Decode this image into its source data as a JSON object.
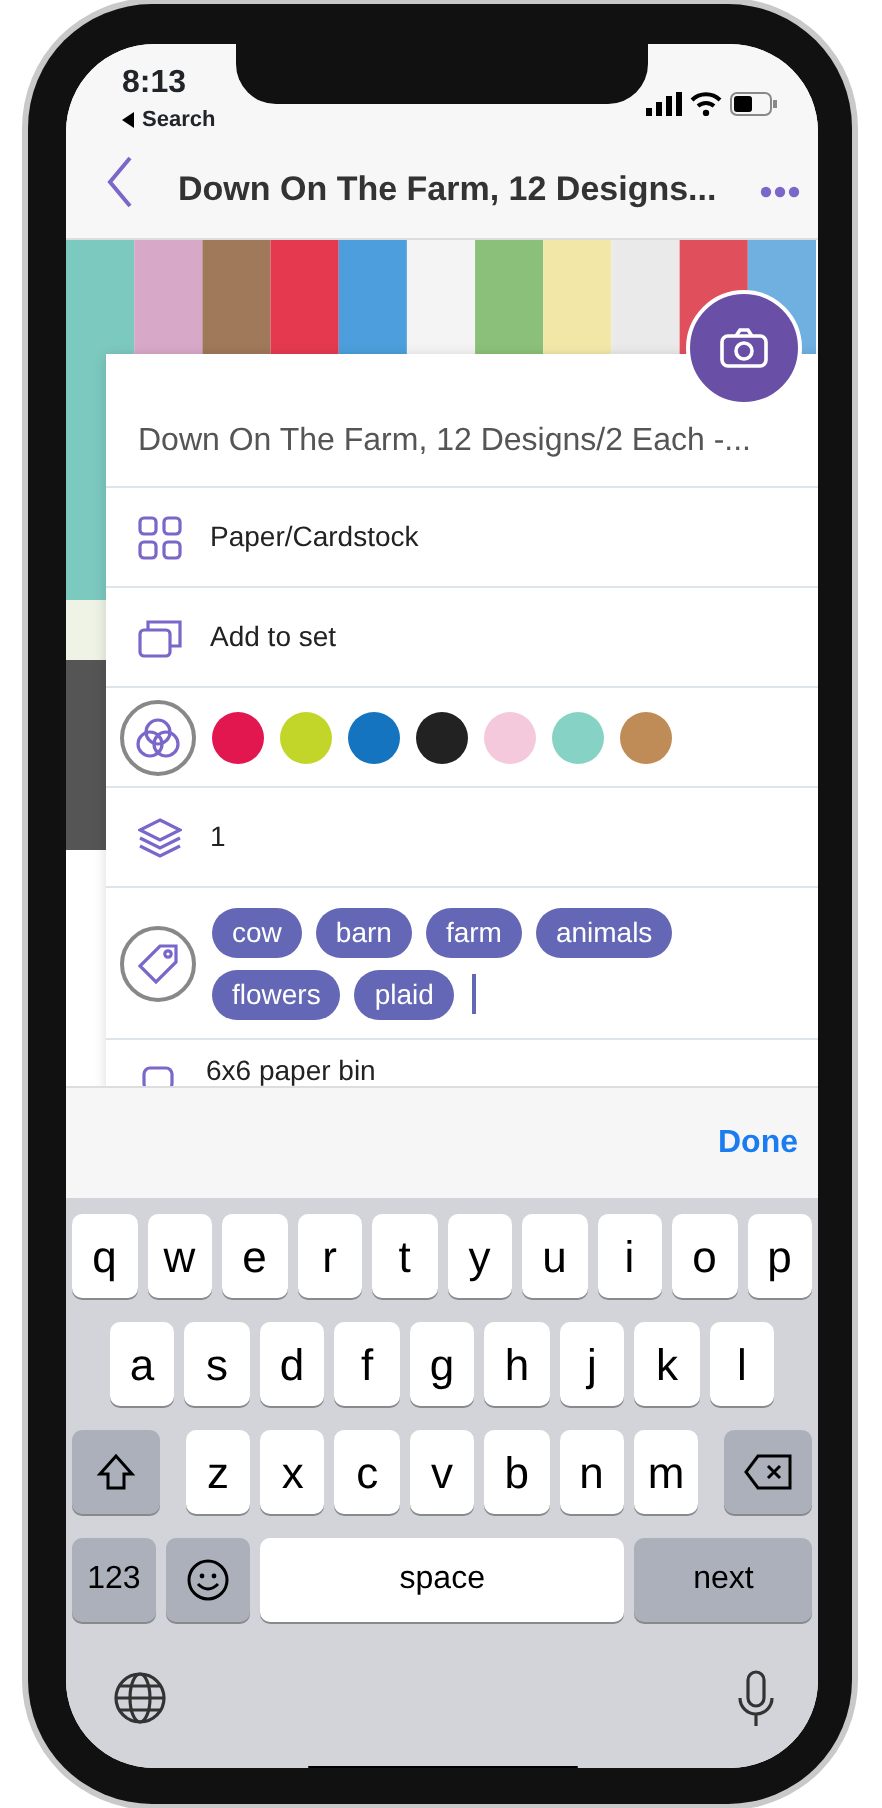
{
  "status_bar": {
    "time": "8:13",
    "back_app": "Search"
  },
  "nav": {
    "title": "Down On The Farm, 12 Designs..."
  },
  "item": {
    "title": "Down On The Farm, 12 Designs/2 Each -...",
    "category": "Paper/Cardstock",
    "set": "Add to set",
    "colors": [
      {
        "color": "#e3174f"
      },
      {
        "color": "#c2d62a"
      },
      {
        "color": "#1474bf"
      },
      {
        "color": "#222222"
      },
      {
        "color": "#f5c9dc"
      },
      {
        "color": "#86d3c5"
      },
      {
        "color": "#bf8c58"
      }
    ],
    "quantity": "1",
    "tags": [
      "cow",
      "barn",
      "farm",
      "animals",
      "flowers",
      "plaid"
    ],
    "location": "6x6 paper bin"
  },
  "keyboard": {
    "accessory": "Done",
    "rows": [
      {
        "keys": [
          {
            "kind": "letter",
            "label": "q"
          },
          {
            "kind": "letter",
            "label": "w"
          },
          {
            "kind": "letter",
            "label": "e"
          },
          {
            "kind": "letter",
            "label": "r"
          },
          {
            "kind": "letter",
            "label": "t"
          },
          {
            "kind": "letter",
            "label": "y"
          },
          {
            "kind": "letter",
            "label": "u"
          },
          {
            "kind": "letter",
            "label": "i"
          },
          {
            "kind": "letter",
            "label": "o"
          },
          {
            "kind": "letter",
            "label": "p"
          }
        ]
      },
      {
        "keys": [
          {
            "kind": "letter",
            "label": "a"
          },
          {
            "kind": "letter",
            "label": "s"
          },
          {
            "kind": "letter",
            "label": "d"
          },
          {
            "kind": "letter",
            "label": "f"
          },
          {
            "kind": "letter",
            "label": "g"
          },
          {
            "kind": "letter",
            "label": "h"
          },
          {
            "kind": "letter",
            "label": "j"
          },
          {
            "kind": "letter",
            "label": "k"
          },
          {
            "kind": "letter",
            "label": "l"
          }
        ]
      },
      {
        "keys": [
          {
            "kind": "shift"
          },
          {
            "kind": "letter",
            "label": "z"
          },
          {
            "kind": "letter",
            "label": "x"
          },
          {
            "kind": "letter",
            "label": "c"
          },
          {
            "kind": "letter",
            "label": "v"
          },
          {
            "kind": "letter",
            "label": "b"
          },
          {
            "kind": "letter",
            "label": "n"
          },
          {
            "kind": "letter",
            "label": "m"
          },
          {
            "kind": "backspace"
          }
        ]
      },
      {
        "keys": [
          {
            "kind": "mode",
            "label": "123"
          },
          {
            "kind": "emoji"
          },
          {
            "kind": "space",
            "label": "space"
          },
          {
            "kind": "return",
            "label": "next"
          }
        ]
      }
    ]
  }
}
